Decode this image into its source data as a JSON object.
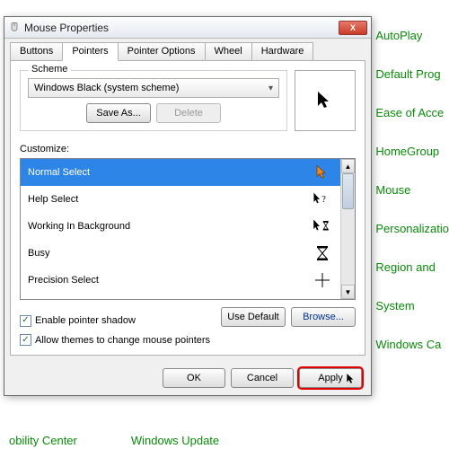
{
  "bg_links": [
    "AutoPlay",
    "Default Prog",
    "Ease of Acce",
    "HomeGroup",
    "Mouse",
    "Personalizatio",
    "Region and",
    "System",
    "Windows Ca"
  ],
  "bg_bottom": [
    "obility Center",
    "Windows Update"
  ],
  "dialog": {
    "title": "Mouse Properties",
    "close_x": "X",
    "tabs": [
      "Buttons",
      "Pointers",
      "Pointer Options",
      "Wheel",
      "Hardware"
    ],
    "active_tab_index": 1,
    "scheme": {
      "legend": "Scheme",
      "selected": "Windows Black (system scheme)",
      "save_as": "Save As...",
      "delete": "Delete"
    },
    "customize_label": "Customize:",
    "cursors": [
      {
        "name": "Normal Select",
        "icon": "arrow-orange"
      },
      {
        "name": "Help Select",
        "icon": "help"
      },
      {
        "name": "Working In Background",
        "icon": "arrow-busy"
      },
      {
        "name": "Busy",
        "icon": "hourglass"
      },
      {
        "name": "Precision Select",
        "icon": "cross"
      }
    ],
    "selected_index": 0,
    "enable_shadow": "Enable pointer shadow",
    "allow_themes": "Allow themes to change mouse pointers",
    "use_default": "Use Default",
    "browse": "Browse...",
    "ok": "OK",
    "cancel": "Cancel",
    "apply": "Apply"
  }
}
